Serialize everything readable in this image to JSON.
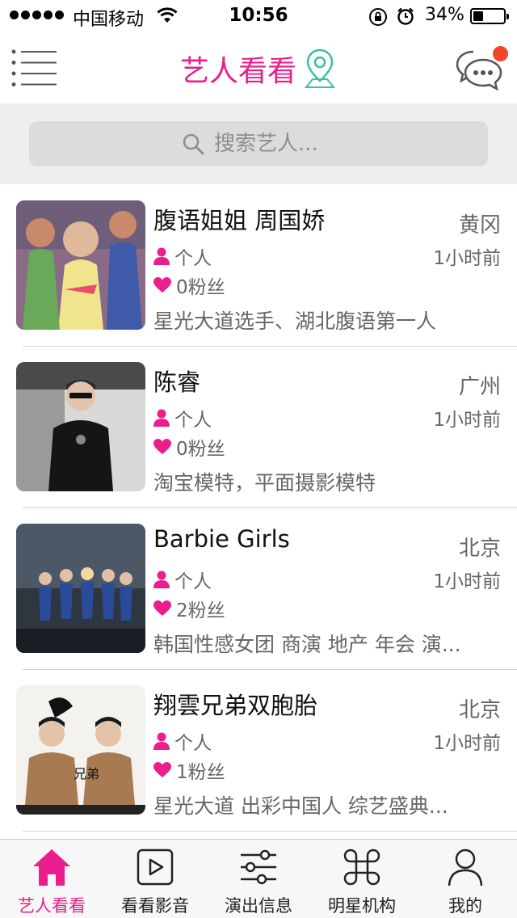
{
  "status_bar": {
    "carrier": "中国移动",
    "time": "10:56",
    "battery": "34%",
    "battery_level": 0.34
  },
  "nav": {
    "title": "艺人看看",
    "accent_color": "#ea1e8c",
    "left_icon": "menu-list-icon",
    "title_icon": "location-pin-icon",
    "right_icon": "chat-bubbles-icon"
  },
  "search": {
    "placeholder": "搜索艺人..."
  },
  "artists": [
    {
      "name": "腹语姐姐 周国娇",
      "city": "黄冈",
      "type": "个人",
      "time": "1小时前",
      "fans": "0粉丝",
      "desc": "星光大道选手、湖北腹语第一人"
    },
    {
      "name": "陈睿",
      "city": "广州",
      "type": "个人",
      "time": "1小时前",
      "fans": "0粉丝",
      "desc": "淘宝模特，平面摄影模特"
    },
    {
      "name": "Barbie Girls",
      "city": "北京",
      "type": "个人",
      "time": "1小时前",
      "fans": "2粉丝",
      "desc": "韩国性感女团 商演 地产 年会 演..."
    },
    {
      "name": "翔雲兄弟双胞胎",
      "city": "北京",
      "type": "个人",
      "time": "1小时前",
      "fans": "1粉丝",
      "desc": "星光大道 出彩中国人 综艺盛典...",
      "thumb_text": "兄弟"
    }
  ],
  "tabs": [
    {
      "label": "艺人看看",
      "icon": "home-icon",
      "active": true
    },
    {
      "label": "看看影音",
      "icon": "play-icon",
      "active": false
    },
    {
      "label": "演出信息",
      "icon": "sliders-icon",
      "active": false
    },
    {
      "label": "明星机构",
      "icon": "command-icon",
      "active": false
    },
    {
      "label": "我的",
      "icon": "user-icon",
      "active": false
    }
  ]
}
